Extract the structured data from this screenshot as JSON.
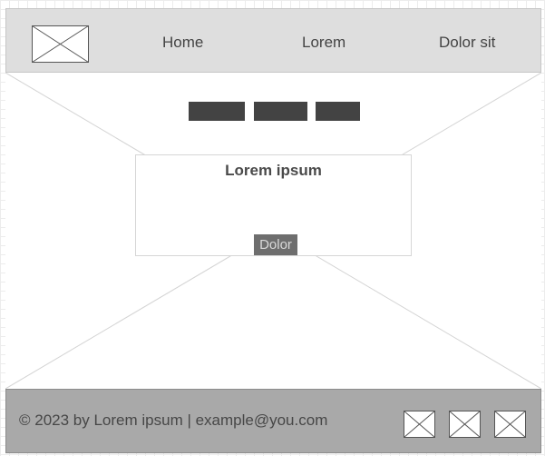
{
  "header": {
    "logo_icon": "image-placeholder-icon",
    "nav": [
      {
        "label": "Home"
      },
      {
        "label": "Lorem"
      },
      {
        "label": "Dolor sit"
      }
    ]
  },
  "hero": {
    "background_icon": "image-placeholder-icon",
    "tab_buttons_count": 3,
    "card": {
      "title": "Lorem ipsum",
      "button_label": "Dolor"
    }
  },
  "footer": {
    "copyright": "© 2023 by Lorem ipsum | example@you.com",
    "social_icons": [
      "image-placeholder-icon",
      "image-placeholder-icon",
      "image-placeholder-icon"
    ]
  },
  "colors": {
    "header_bg": "#dedede",
    "footer_bg": "#a9a9a9",
    "dark_button": "#434343",
    "card_button": "#6e6e6e"
  }
}
